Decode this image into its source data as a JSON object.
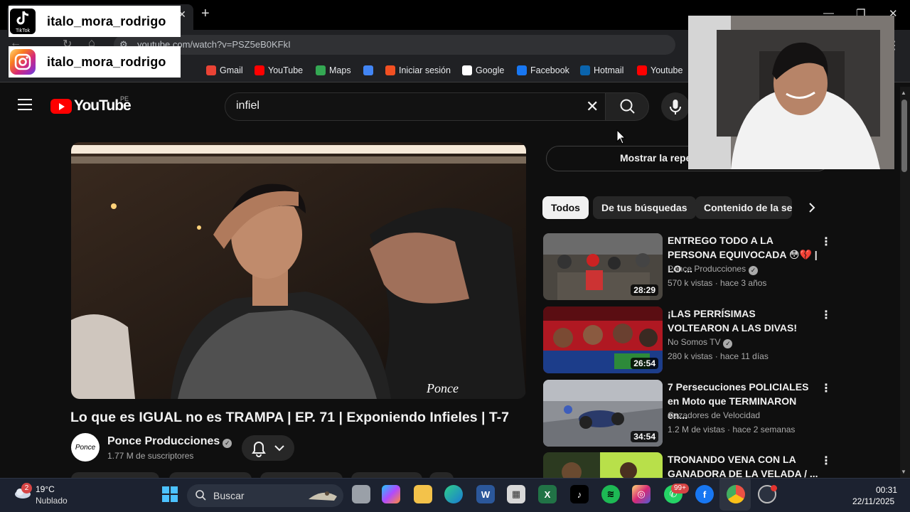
{
  "browser": {
    "url": "youtube.com/watch?v=PSZ5eB0KFkI",
    "bookmarks": [
      {
        "label": "Gmail",
        "icon": "gmail-icon",
        "color": "#ea4335"
      },
      {
        "label": "YouTube",
        "icon": "youtube-icon",
        "color": "#ff0000"
      },
      {
        "label": "Maps",
        "icon": "maps-icon",
        "color": "#34a853"
      },
      {
        "label": "",
        "icon": "google-plus-icon",
        "color": "#4285f4"
      },
      {
        "label": "Iniciar sesión",
        "icon": "microsoft-icon",
        "color": "#f25022"
      },
      {
        "label": "Google",
        "icon": "google-icon",
        "color": "#ffffff"
      },
      {
        "label": "Facebook",
        "icon": "facebook-icon",
        "color": "#1877f2"
      },
      {
        "label": "Hotmail",
        "icon": "outlook-icon",
        "color": "#0a64ad"
      },
      {
        "label": "Youtube",
        "icon": "youtube-icon",
        "color": "#ff0000"
      }
    ]
  },
  "overlay": {
    "tiktok_handle": "italo_mora_rodrigo",
    "tiktok_label": "TikTok",
    "instagram_handle": "italo_mora_rodrigo"
  },
  "youtube": {
    "logo_text": "YouTube",
    "country": "PE",
    "search_query": "infiel",
    "video": {
      "title": "Lo que es IGUAL no es TRAMPA | EP. 71 | Exponiendo Infieles | T-7",
      "channel": "Ponce Producciones",
      "subscribers": "1.77 M de suscriptores",
      "avatar_text": "Ponce"
    },
    "chat_replay_label": "Mostrar la repe",
    "chips": [
      "Todos",
      "De tus búsquedas",
      "Contenido de la ser"
    ],
    "recommendations": [
      {
        "title": "ENTREGO TODO A LA PERSONA EQUIVOCADA 😳💔 | LO ...",
        "channel": "Ponce Producciones",
        "meta": "570 k vistas · hace 3 años",
        "duration": "28:29"
      },
      {
        "title": "¡LAS PERRÍSIMAS VOLTEARON A LAS DIVAS!",
        "channel": "No Somos TV",
        "meta": "280 k vistas · hace 11 días",
        "duration": "26:54"
      },
      {
        "title": "7 Persecuciones POLICIALES en Moto que TERMINARON en...",
        "channel": "Cazadores de Velocidad",
        "meta": "1.2 M de vistas · hace 2 semanas",
        "duration": "34:54"
      },
      {
        "title": "TRONANDO VENA CON LA GANADORA DE LA VELADA / ...",
        "channel": "",
        "meta": "",
        "duration": ""
      }
    ]
  },
  "taskbar": {
    "weather_temp": "19°C",
    "weather_desc": "Nublado",
    "weather_badge": "2",
    "search_placeholder": "Buscar",
    "whatsapp_badge": "99+",
    "time": "00:31",
    "date": "22/11/2025"
  }
}
